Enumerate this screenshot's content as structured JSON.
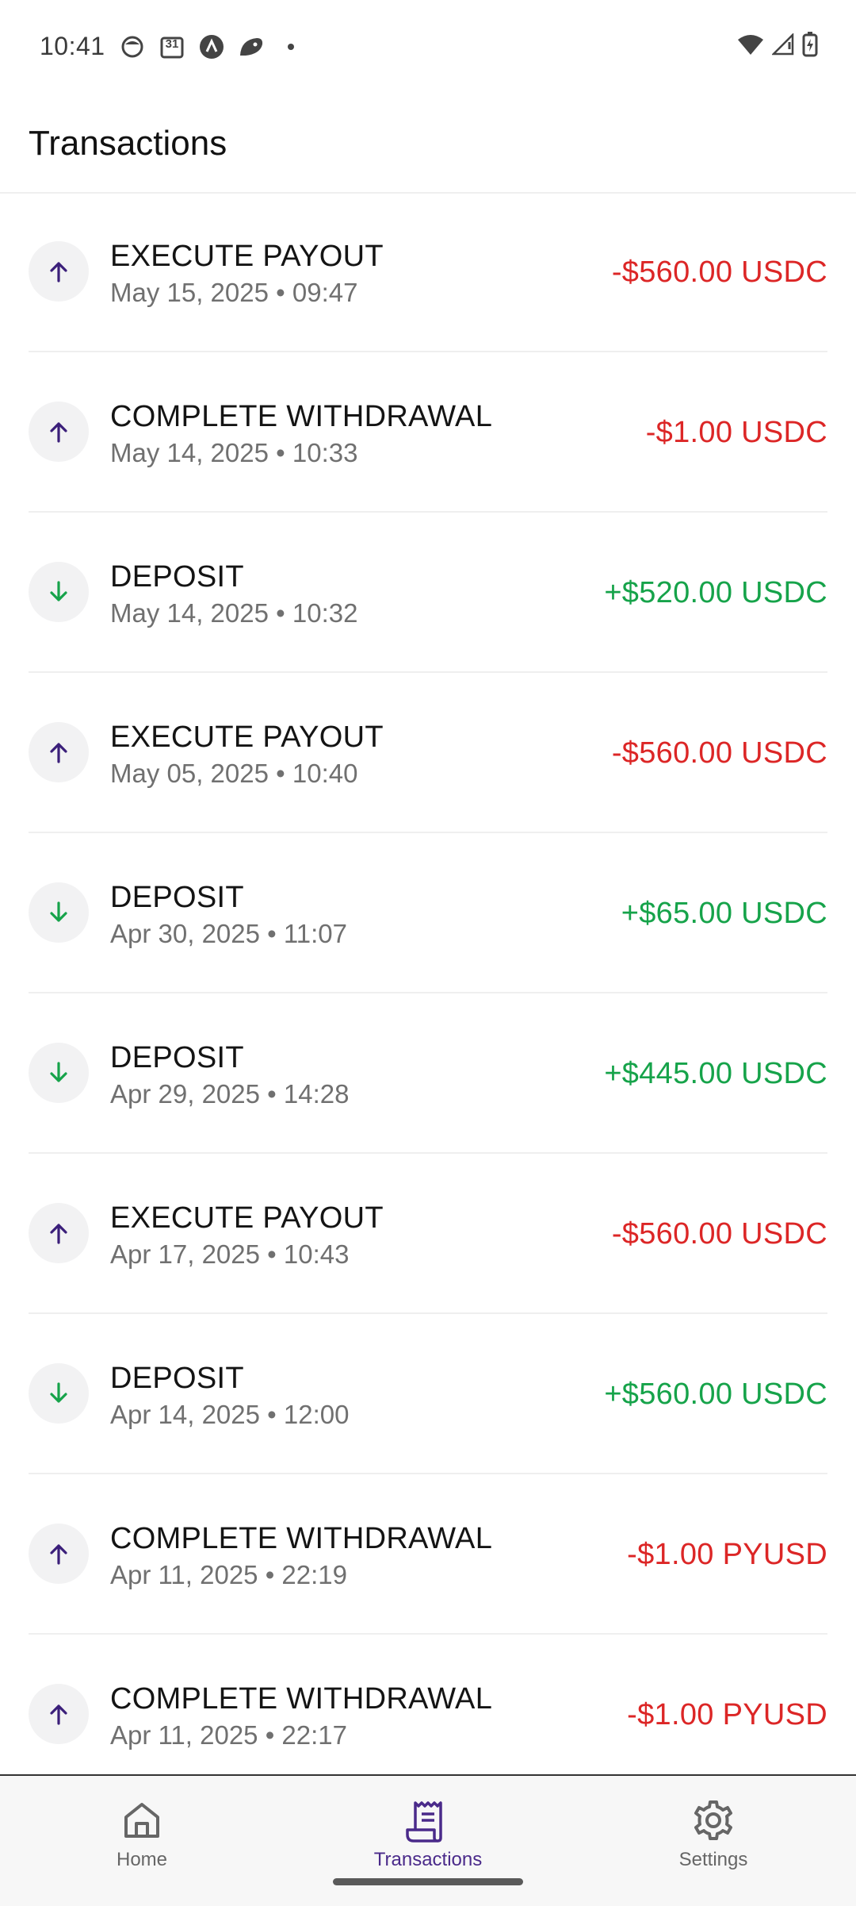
{
  "status_bar": {
    "time": "10:41",
    "calendar_day": "31",
    "icons": [
      "face-icon",
      "calendar-icon",
      "app-a-icon",
      "leaf-icon",
      "dot-icon",
      "wifi-icon",
      "signal-icon",
      "battery-icon"
    ]
  },
  "header": {
    "title": "Transactions"
  },
  "transactions": [
    {
      "direction": "out",
      "title": "EXECUTE PAYOUT",
      "date": "May 15, 2025",
      "time": "09:47",
      "amount": "-$560.00 USDC"
    },
    {
      "direction": "out",
      "title": "COMPLETE WITHDRAWAL",
      "date": "May 14, 2025",
      "time": "10:33",
      "amount": "-$1.00 USDC"
    },
    {
      "direction": "in",
      "title": "DEPOSIT",
      "date": "May 14, 2025",
      "time": "10:32",
      "amount": "+$520.00 USDC"
    },
    {
      "direction": "out",
      "title": "EXECUTE PAYOUT",
      "date": "May 05, 2025",
      "time": "10:40",
      "amount": "-$560.00 USDC"
    },
    {
      "direction": "in",
      "title": "DEPOSIT",
      "date": "Apr 30, 2025",
      "time": "11:07",
      "amount": "+$65.00 USDC"
    },
    {
      "direction": "in",
      "title": "DEPOSIT",
      "date": "Apr 29, 2025",
      "time": "14:28",
      "amount": "+$445.00 USDC"
    },
    {
      "direction": "out",
      "title": "EXECUTE PAYOUT",
      "date": "Apr 17, 2025",
      "time": "10:43",
      "amount": "-$560.00 USDC"
    },
    {
      "direction": "in",
      "title": "DEPOSIT",
      "date": "Apr 14, 2025",
      "time": "12:00",
      "amount": "+$560.00 USDC"
    },
    {
      "direction": "out",
      "title": "COMPLETE WITHDRAWAL",
      "date": "Apr 11, 2025",
      "time": "22:19",
      "amount": "-$1.00 PYUSD"
    },
    {
      "direction": "out",
      "title": "COMPLETE WITHDRAWAL",
      "date": "Apr 11, 2025",
      "time": "22:17",
      "amount": "-$1.00 PYUSD"
    }
  ],
  "nav": {
    "home_label": "Home",
    "transactions_label": "Transactions",
    "settings_label": "Settings",
    "active": "transactions"
  },
  "colors": {
    "negative": "#dc2626",
    "positive": "#16a34a",
    "out_arrow": "#3b1f7a",
    "in_arrow": "#16a34a",
    "accent": "#4a2a8a"
  }
}
